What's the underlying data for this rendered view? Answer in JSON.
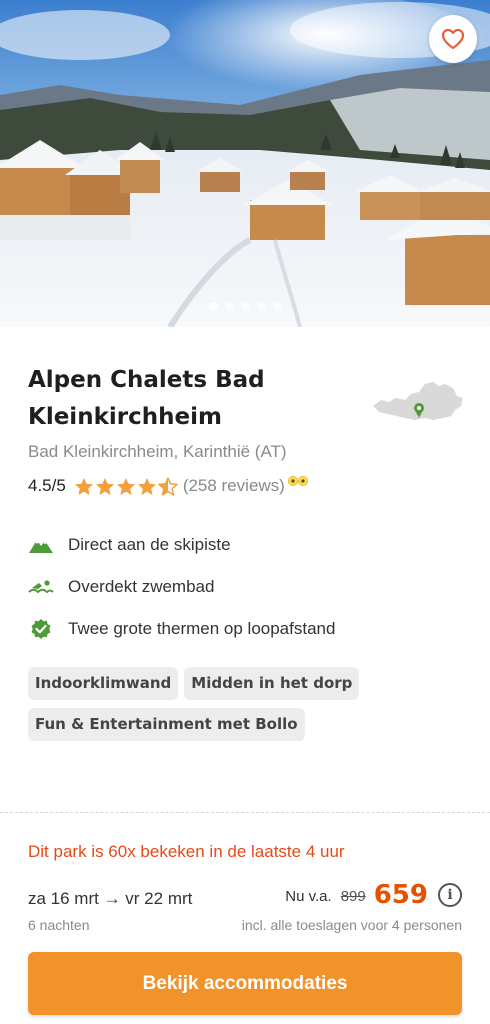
{
  "hero": {
    "image_alt": "Alpen Chalets Bad Kleinkirchheim",
    "slide_count": 5,
    "active_slide": 1,
    "favorite_icon": "heart-outline-icon",
    "favorite_color": "#e8603c"
  },
  "park": {
    "title_line1": "Alpen Chalets Bad",
    "title_line2": "Kleinkirchheim",
    "location": "Bad Kleinkirchheim, Karinthië (AT)",
    "map_icon": "austria-map-icon",
    "rating_value": "4.5/5",
    "rating_stars": 4.5,
    "reviews": "(258 reviews)",
    "review_icon": "tripadvisor-owl-icon"
  },
  "features": [
    {
      "icon": "mountain-icon",
      "label": "Direct aan de skipiste"
    },
    {
      "icon": "swimmer-icon",
      "label": "Overdekt zwembad"
    },
    {
      "icon": "check-badge-icon",
      "label": "Twee grote thermen op loopafstand"
    }
  ],
  "tags": [
    "Indoorklimwand",
    "Midden in het dorp",
    "Fun & Entertainment met Bollo"
  ],
  "urgency": "Dit park is 60x bekeken in de laatste 4 uur",
  "stay": {
    "dates": "za 16 mrt → vr 22 mrt",
    "nights": "6 nachten"
  },
  "price": {
    "prefix": "Nu v.a.",
    "old": "899",
    "new": "659",
    "info_icon": "info-icon",
    "note": "incl. alle toeslagen voor 4 personen"
  },
  "cta_label": "Bekijk accommodaties",
  "colors": {
    "accent": "#f0932b",
    "price": "#e65100",
    "urgency": "#e64a19",
    "feature_icon": "#4f9a3a",
    "star": "#f2a03d"
  }
}
